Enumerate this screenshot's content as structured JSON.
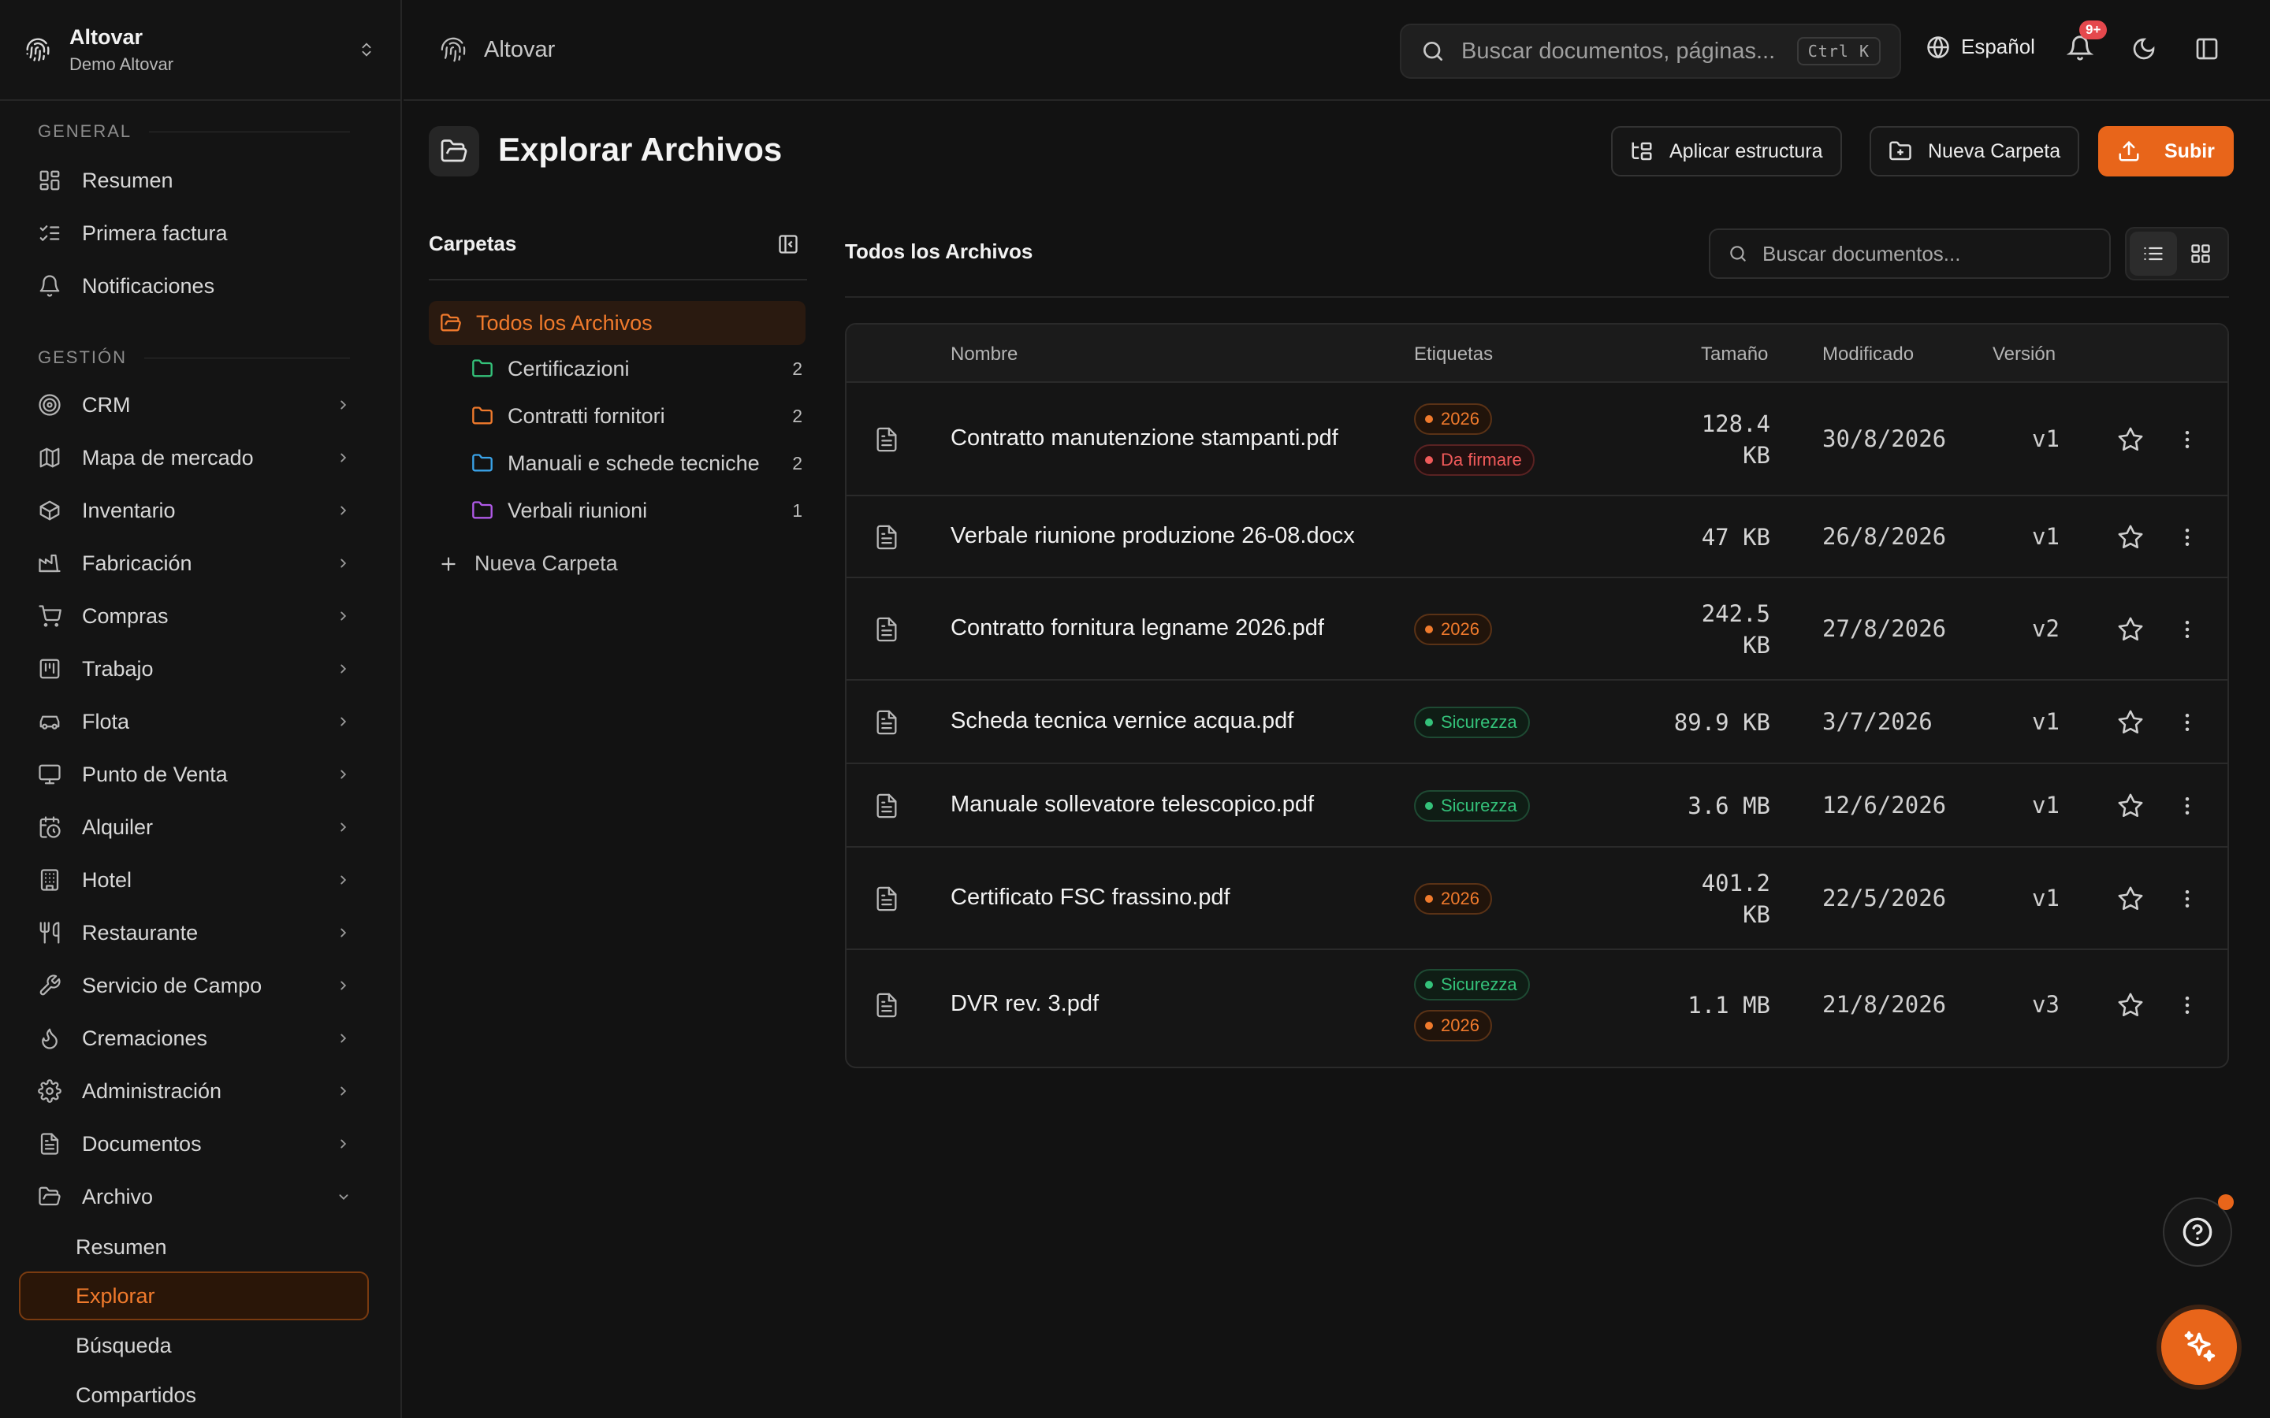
{
  "org": {
    "name": "Altovar",
    "subtitle": "Demo Altovar"
  },
  "sidebar": {
    "sections": [
      {
        "title": "GENERAL"
      },
      {
        "title": "GESTIÓN"
      }
    ],
    "general": [
      {
        "label": "Resumen",
        "icon": "dashboard-icon"
      },
      {
        "label": "Primera factura",
        "icon": "checklist-icon"
      },
      {
        "label": "Notificaciones",
        "icon": "bell-icon"
      }
    ],
    "gestion": [
      {
        "label": "CRM",
        "icon": "target-icon"
      },
      {
        "label": "Mapa de mercado",
        "icon": "map-icon"
      },
      {
        "label": "Inventario",
        "icon": "box-icon"
      },
      {
        "label": "Fabricación",
        "icon": "factory-icon"
      },
      {
        "label": "Compras",
        "icon": "cart-icon"
      },
      {
        "label": "Trabajo",
        "icon": "kanban-icon"
      },
      {
        "label": "Flota",
        "icon": "car-icon"
      },
      {
        "label": "Punto de Venta",
        "icon": "monitor-icon"
      },
      {
        "label": "Alquiler",
        "icon": "calendar-clock-icon"
      },
      {
        "label": "Hotel",
        "icon": "building-icon"
      },
      {
        "label": "Restaurante",
        "icon": "utensils-icon"
      },
      {
        "label": "Servicio de Campo",
        "icon": "wrench-icon"
      },
      {
        "label": "Cremaciones",
        "icon": "flame-icon"
      },
      {
        "label": "Administración",
        "icon": "gear-icon"
      },
      {
        "label": "Documentos",
        "icon": "document-icon"
      },
      {
        "label": "Archivo",
        "icon": "folder-open-icon"
      }
    ],
    "archivo_sub": [
      {
        "label": "Resumen"
      },
      {
        "label": "Explorar",
        "active": true
      },
      {
        "label": "Búsqueda"
      },
      {
        "label": "Compartidos"
      }
    ]
  },
  "topbar": {
    "breadcrumb": "Altovar",
    "search_placeholder": "Buscar documentos, páginas...",
    "shortcut": "Ctrl K",
    "language": "Español",
    "notifications_badge": "9+"
  },
  "page": {
    "title": "Explorar Archivos",
    "buttons": {
      "apply_structure": "Aplicar estructura",
      "new_folder": "Nueva Carpeta",
      "upload": "Subir"
    }
  },
  "folders": {
    "title": "Carpetas",
    "all": "Todos los Archivos",
    "items": [
      {
        "label": "Certificazioni",
        "count": "2",
        "color": "#34c27a"
      },
      {
        "label": "Contratti fornitori",
        "count": "2",
        "color": "#f07a2c"
      },
      {
        "label": "Manuali e schede tecniche",
        "count": "2",
        "color": "#3aa3e8"
      },
      {
        "label": "Verbali riunioni",
        "count": "1",
        "color": "#b05ae8"
      }
    ],
    "new_folder": "Nueva Carpeta"
  },
  "files": {
    "title": "Todos los Archivos",
    "search_placeholder": "Buscar documentos...",
    "columns": {
      "name": "Nombre",
      "tags": "Etiquetas",
      "size": "Tamaño",
      "modified": "Modificado",
      "version": "Versión"
    },
    "rows": [
      {
        "name": "Contratto manutenzione stampanti.pdf",
        "tags": [
          {
            "label": "2026",
            "color": "orange"
          },
          {
            "label": "Da firmare",
            "color": "red"
          }
        ],
        "size": [
          "128.4",
          "KB"
        ],
        "modified": "30/8/2026",
        "version": "v1"
      },
      {
        "name": "Verbale riunione produzione 26-08.docx",
        "tags": [],
        "size": [
          "47 KB"
        ],
        "modified": "26/8/2026",
        "version": "v1"
      },
      {
        "name": "Contratto fornitura legname 2026.pdf",
        "tags": [
          {
            "label": "2026",
            "color": "orange"
          }
        ],
        "size": [
          "242.5",
          "KB"
        ],
        "modified": "27/8/2026",
        "version": "v2"
      },
      {
        "name": "Scheda tecnica vernice acqua.pdf",
        "tags": [
          {
            "label": "Sicurezza",
            "color": "green"
          }
        ],
        "size": [
          "89.9 KB"
        ],
        "modified": "3/7/2026",
        "version": "v1"
      },
      {
        "name": "Manuale sollevatore telescopico.pdf",
        "tags": [
          {
            "label": "Sicurezza",
            "color": "green"
          }
        ],
        "size": [
          "3.6 MB"
        ],
        "modified": "12/6/2026",
        "version": "v1"
      },
      {
        "name": "Certificato FSC frassino.pdf",
        "tags": [
          {
            "label": "2026",
            "color": "orange"
          }
        ],
        "size": [
          "401.2",
          "KB"
        ],
        "modified": "22/5/2026",
        "version": "v1"
      },
      {
        "name": "DVR rev. 3.pdf",
        "tags": [
          {
            "label": "Sicurezza",
            "color": "green"
          },
          {
            "label": "2026",
            "color": "orange"
          }
        ],
        "size": [
          "1.1 MB"
        ],
        "modified": "21/8/2026",
        "version": "v3"
      }
    ]
  }
}
